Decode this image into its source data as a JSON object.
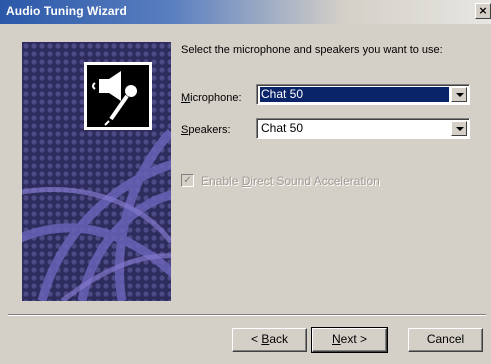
{
  "window": {
    "title": "Audio Tuning Wizard",
    "close_glyph": "×"
  },
  "content": {
    "prompt": "Select the microphone and speakers you want to use:",
    "microphone": {
      "label_prefix": "",
      "label_mnemonic": "M",
      "label_rest": "icrophone:",
      "value": "Chat 50"
    },
    "speakers": {
      "label_mnemonic": "S",
      "label_rest": "peakers:",
      "value": "Chat 50"
    },
    "acceleration": {
      "label_before": "Enable ",
      "label_mnemonic": "D",
      "label_after": "irect Sound Acceleration",
      "checked": true,
      "enabled": false
    }
  },
  "buttons": {
    "back": {
      "prefix": "< ",
      "mnemonic": "B",
      "rest": "ack"
    },
    "next": {
      "mnemonic": "N",
      "rest": "ext >"
    },
    "cancel": {
      "label": "Cancel"
    }
  },
  "icons": {
    "side_panel": "globe-pattern-graphic",
    "speaker_mic": "speaker-microphone-icon",
    "dropdown": "chevron-down-icon"
  },
  "colors": {
    "title_start": "#2a58a8",
    "panel": "#3b3a72",
    "selection": "#0a246a",
    "face": "#d4d0c8"
  }
}
